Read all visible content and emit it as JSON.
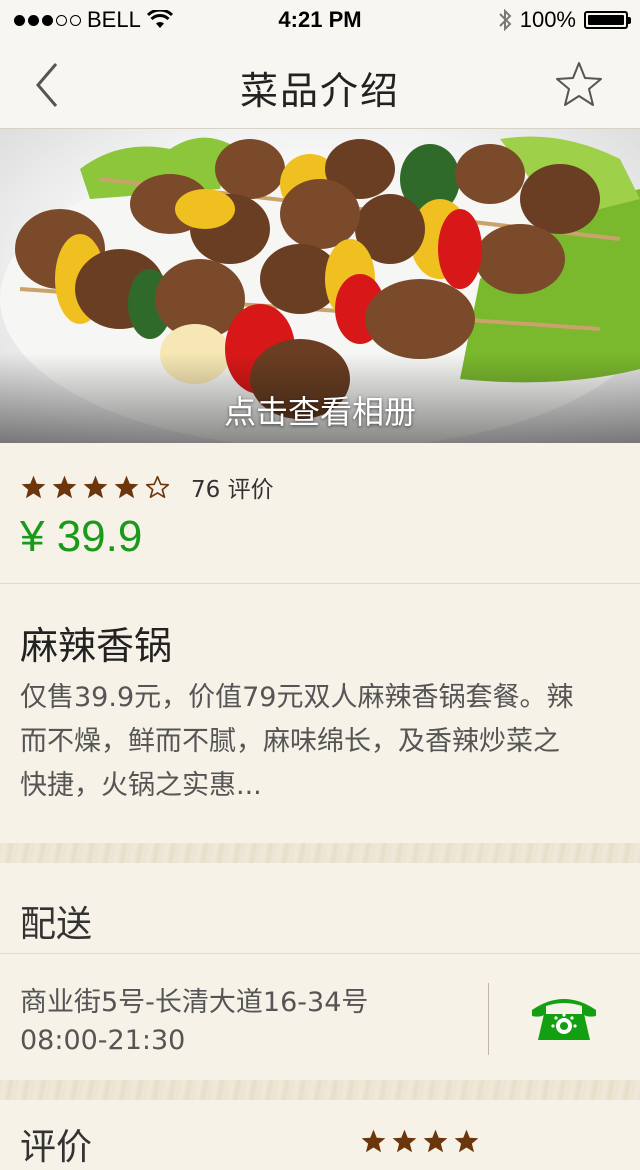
{
  "status_bar": {
    "carrier": "BELL",
    "time": "4:21 PM",
    "battery": "100%"
  },
  "nav": {
    "title": "菜品介绍"
  },
  "hero": {
    "caption": "点击查看相册"
  },
  "rating": {
    "stars": 4,
    "max": 5,
    "count_text": "76 评价"
  },
  "price": "¥ 39.9",
  "dish": {
    "name": "麻辣香锅",
    "desc_lines": [
      "仅售39.9元，价值79元双人麻辣香锅套餐。辣",
      "而不燥，鲜而不腻，麻味绵长，及香辣炒菜之",
      "快捷，火锅之实惠..."
    ]
  },
  "delivery": {
    "title": "配送",
    "address": "商业街5号-长清大道16-34号",
    "hours": "08:00-21:30"
  },
  "review": {
    "title": "评价"
  },
  "colors": {
    "accent_green": "#1a9a1a",
    "star_brown": "#7a3a0a",
    "background": "#f7f2e8"
  }
}
